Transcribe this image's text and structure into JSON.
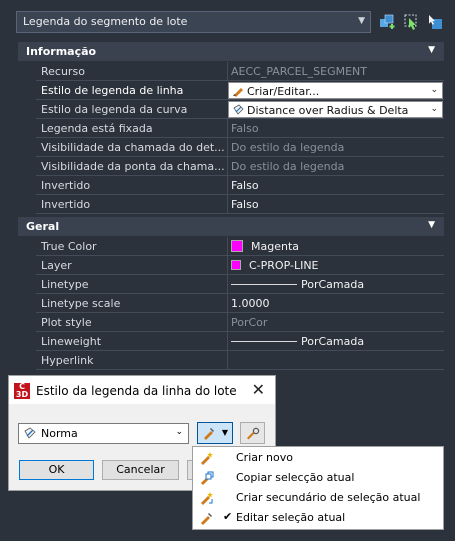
{
  "top_selector": {
    "value": "Legenda do segmento de lote",
    "icons": [
      "add-selection-icon",
      "quick-select-icon",
      "toggle-pickadd-icon"
    ]
  },
  "sections": {
    "info": {
      "title": "Informação"
    },
    "general": {
      "title": "Geral"
    }
  },
  "info_rows": [
    {
      "label": "Recurso",
      "value": "AECC_PARCEL_SEGMENT"
    },
    {
      "label": "Estilo de legenda de linha",
      "value": "Criar/Editar..."
    },
    {
      "label": "Estilo da legenda da curva",
      "value": "Distance over Radius & Delta"
    },
    {
      "label": "Legenda está fixada",
      "value": "Falso"
    },
    {
      "label": "Visibilidade da chamada do det...",
      "value": "Do estilo da legenda"
    },
    {
      "label": "Visibilidade da ponta da chama...",
      "value": "Do estilo da legenda"
    },
    {
      "label": "Invertido",
      "value": "Falso"
    },
    {
      "label": "Invertido",
      "value": "Falso"
    }
  ],
  "general_rows": [
    {
      "label": "True Color",
      "value": "Magenta"
    },
    {
      "label": "Layer",
      "value": "C-PROP-LINE"
    },
    {
      "label": "Linetype",
      "value": "PorCamada"
    },
    {
      "label": "Linetype scale",
      "value": "1.0000"
    },
    {
      "label": "Plot style",
      "value": "PorCor"
    },
    {
      "label": "Lineweight",
      "value": "PorCamada"
    },
    {
      "label": "Hyperlink",
      "value": ""
    }
  ],
  "colors": {
    "magenta": "#ff00ff",
    "accent": "#0078d7"
  },
  "dialog": {
    "title": "Estilo da legenda da linha do lote",
    "app_badge": "C 3D",
    "style_value": "Norma",
    "ok_label": "OK",
    "cancel_label": "Cancelar",
    "menu": [
      {
        "label": "Criar novo",
        "checked": false
      },
      {
        "label": "Copiar selecção atual",
        "checked": false
      },
      {
        "label": "Criar secundário de seleção atual",
        "checked": false
      },
      {
        "label": "Editar seleção atual",
        "checked": true
      }
    ],
    "check_glyph": "✔"
  }
}
